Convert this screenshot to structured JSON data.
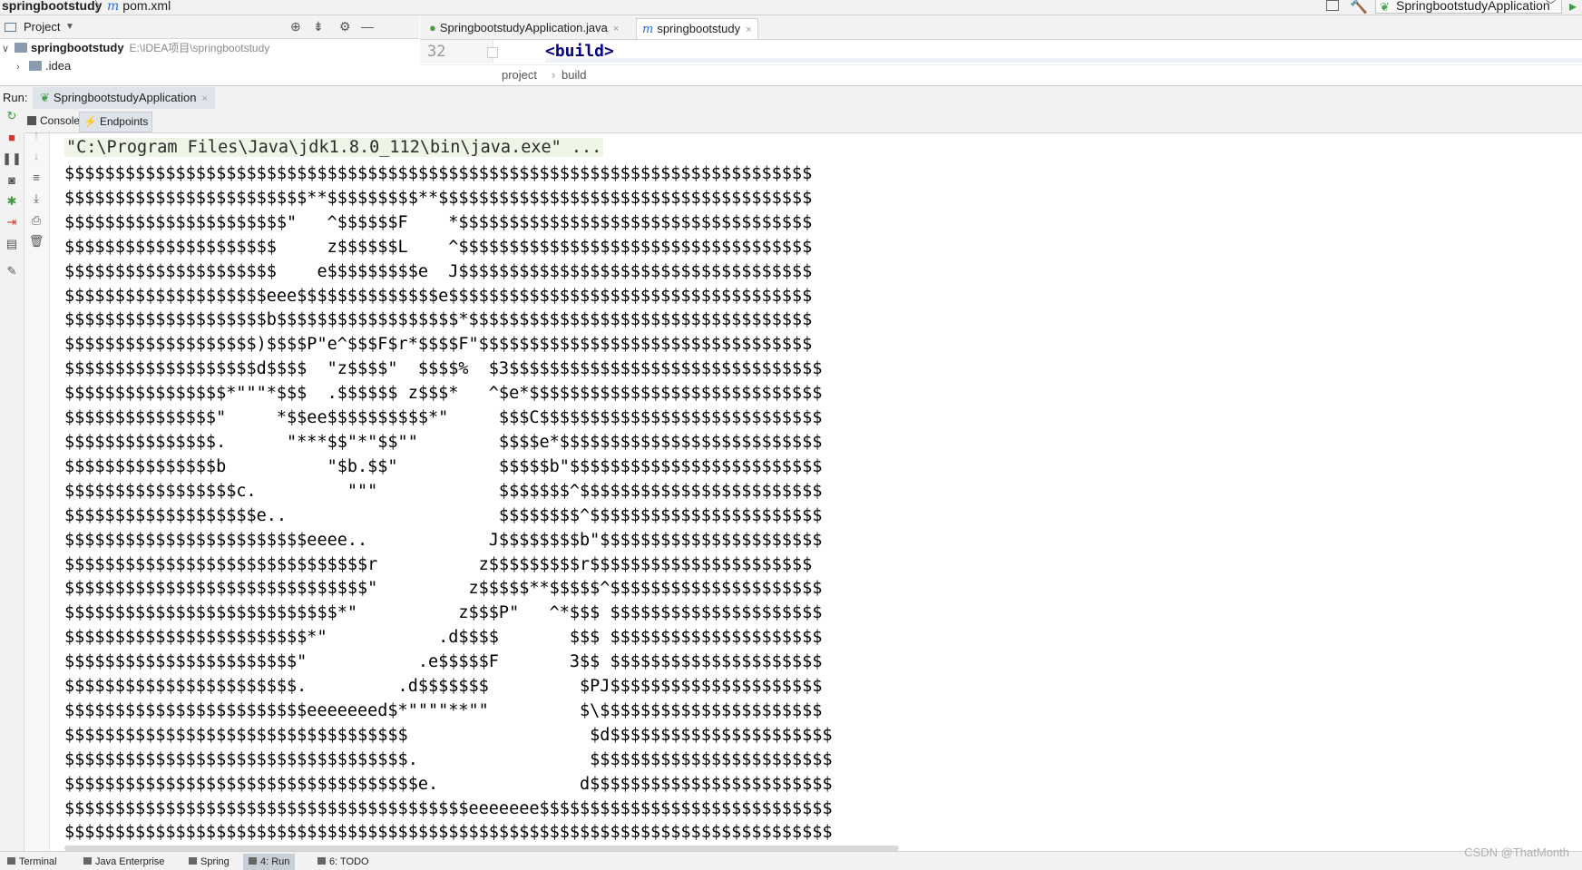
{
  "navbar": {
    "project_name": "springbootstudy",
    "separator": "〉",
    "file_name": "pom.xml",
    "file_icon": "m",
    "run_config": "SpringbootstudyApplication"
  },
  "project_panel": {
    "title": "Project",
    "tree": [
      {
        "label": "springbootstudy",
        "path": "E:\\IDEA项目\\springbootstudy"
      },
      {
        "label": ".idea",
        "path": ""
      }
    ]
  },
  "editor": {
    "tabs": [
      {
        "label": "SpringbootstudyApplication.java",
        "close": "×"
      },
      {
        "label": "springbootstudy",
        "close": "×"
      }
    ],
    "line_number": "32",
    "code_line": "<build>",
    "breadcrumb": [
      "project",
      "build"
    ],
    "breadcrumb_sep": "›"
  },
  "run": {
    "label": "Run:",
    "config_tab": "SpringbootstudyApplication",
    "close": "×",
    "console_tabs": [
      "Console",
      "Endpoints"
    ]
  },
  "console": {
    "command": "\"C:\\Program Files\\Java\\jdk1.8.0_112\\bin\\java.exe\" ...",
    "banner": "$$$$$$$$$$$$$$$$$$$$$$$$$$$$$$$$$$$$$$$$$$$$$$$$$$$$$$$$$$$$$$$$$$$$$$$$$$\n$$$$$$$$$$$$$$$$$$$$$$$$**$$$$$$$$$**$$$$$$$$$$$$$$$$$$$$$$$$$$$$$$$$$$$$$\n$$$$$$$$$$$$$$$$$$$$$$\"   ^$$$$$$F    *$$$$$$$$$$$$$$$$$$$$$$$$$$$$$$$$$$$\n$$$$$$$$$$$$$$$$$$$$$     z$$$$$$L    ^$$$$$$$$$$$$$$$$$$$$$$$$$$$$$$$$$$$\n$$$$$$$$$$$$$$$$$$$$$    e$$$$$$$$$e  J$$$$$$$$$$$$$$$$$$$$$$$$$$$$$$$$$$$\n$$$$$$$$$$$$$$$$$$$$eee$$$$$$$$$$$$$$e$$$$$$$$$$$$$$$$$$$$$$$$$$$$$$$$$$$$\n$$$$$$$$$$$$$$$$$$$$b$$$$$$$$$$$$$$$$$$*$$$$$$$$$$$$$$$$$$$$$$$$$$$$$$$$$$\n$$$$$$$$$$$$$$$$$$$)$$$$P\"e^$$$F$r*$$$$F\"$$$$$$$$$$$$$$$$$$$$$$$$$$$$$$$$$\n$$$$$$$$$$$$$$$$$$$d$$$$  \"z$$$$\"  $$$$%  $3$$$$$$$$$$$$$$$$$$$$$$$$$$$$$$$\n$$$$$$$$$$$$$$$$*\"\"\"*$$$  .$$$$$$ z$$$*   ^$e*$$$$$$$$$$$$$$$$$$$$$$$$$$$$$\n$$$$$$$$$$$$$$$\"     *$$ee$$$$$$$$$$*\"     $$$C$$$$$$$$$$$$$$$$$$$$$$$$$$$$\n$$$$$$$$$$$$$$$.      \"***$$\"*\"$$\"\"        $$$$e*$$$$$$$$$$$$$$$$$$$$$$$$$$\n$$$$$$$$$$$$$$$b          \"$b.$$\"          $$$$$b\"$$$$$$$$$$$$$$$$$$$$$$$$$\n$$$$$$$$$$$$$$$$$c.         \"\"\"            $$$$$$$^$$$$$$$$$$$$$$$$$$$$$$$$\n$$$$$$$$$$$$$$$$$$$e..                     $$$$$$$$^$$$$$$$$$$$$$$$$$$$$$$$\n$$$$$$$$$$$$$$$$$$$$$$$$eeee..            J$$$$$$$$b\"$$$$$$$$$$$$$$$$$$$$$$\n$$$$$$$$$$$$$$$$$$$$$$$$$$$$$$r          z$$$$$$$$$r$$$$$$$$$$$$$$$$$$$$$$\n$$$$$$$$$$$$$$$$$$$$$$$$$$$$$$\"         z$$$$$**$$$$$^$$$$$$$$$$$$$$$$$$$$$\n$$$$$$$$$$$$$$$$$$$$$$$$$$$*\"          z$$$P\"   ^*$$$ $$$$$$$$$$$$$$$$$$$$$\n$$$$$$$$$$$$$$$$$$$$$$$$*\"           .d$$$$       $$$ $$$$$$$$$$$$$$$$$$$$$\n$$$$$$$$$$$$$$$$$$$$$$$\"           .e$$$$$F       3$$ $$$$$$$$$$$$$$$$$$$$$\n$$$$$$$$$$$$$$$$$$$$$$$.         .d$$$$$$$         $PJ$$$$$$$$$$$$$$$$$$$$$\n$$$$$$$$$$$$$$$$$$$$$$$$eeeeeeed$*\"\"\"\"**\"\"         $\\$$$$$$$$$$$$$$$$$$$$$$\n$$$$$$$$$$$$$$$$$$$$$$$$$$$$$$$$$$                  $d$$$$$$$$$$$$$$$$$$$$$$\n$$$$$$$$$$$$$$$$$$$$$$$$$$$$$$$$$$.                 $$$$$$$$$$$$$$$$$$$$$$$$\n$$$$$$$$$$$$$$$$$$$$$$$$$$$$$$$$$$$e.              d$$$$$$$$$$$$$$$$$$$$$$$$\n$$$$$$$$$$$$$$$$$$$$$$$$$$$$$$$$$$$$$$$$eeeeeee$$$$$$$$$$$$$$$$$$$$$$$$$$$$$\n$$$$$$$$$$$$$$$$$$$$$$$$$$$$$$$$$$$$$$$$$$$$$$$$$$$$$$$$$$$$$$$$$$$$$$$$$$$$"
  },
  "bottom_bar": {
    "tabs": [
      "Terminal",
      "Java Enterprise",
      "Spring",
      "4: Run",
      "6: TODO"
    ]
  },
  "watermark": "CSDN @ThatMonth"
}
